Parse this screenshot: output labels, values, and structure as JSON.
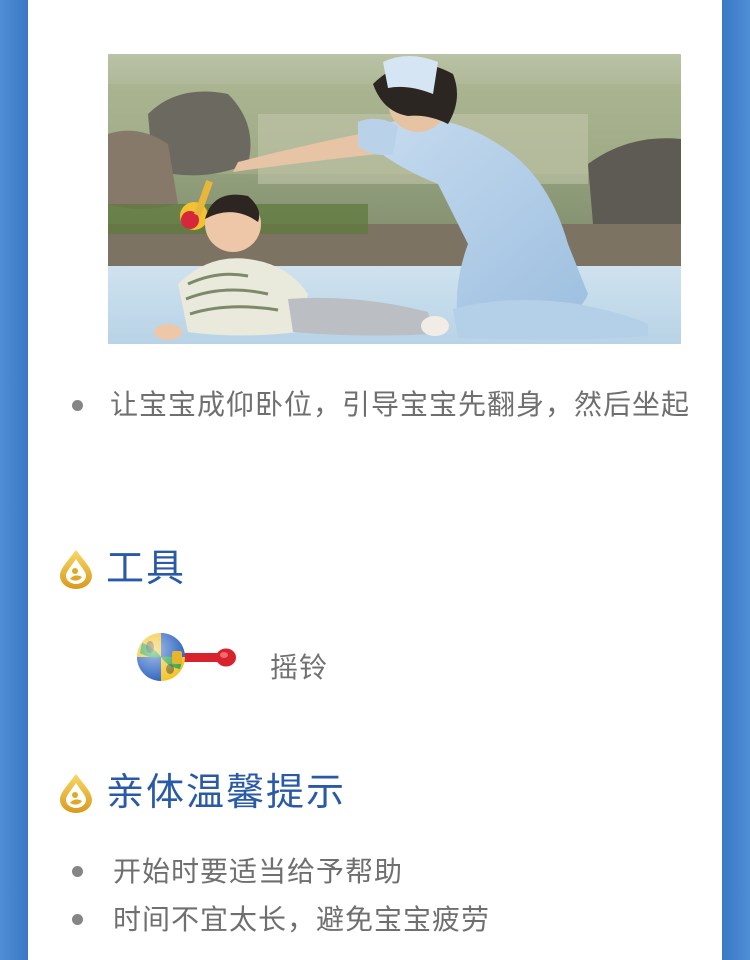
{
  "step": {
    "instruction": "让宝宝成仰卧位，引导宝宝先翻身，然后坐起"
  },
  "tools_section": {
    "title": "工具",
    "items": [
      {
        "label": "摇铃",
        "icon": "rattle-icon"
      }
    ]
  },
  "tips_section": {
    "title": "亲体温馨提示",
    "tips": [
      "开始时要适当给予帮助",
      "时间不宜太长，避免宝宝疲劳"
    ]
  },
  "colors": {
    "accent_blue": "#2a5aa7",
    "side_blue": "#3a77c4",
    "text_gray": "#6f6f6f"
  }
}
